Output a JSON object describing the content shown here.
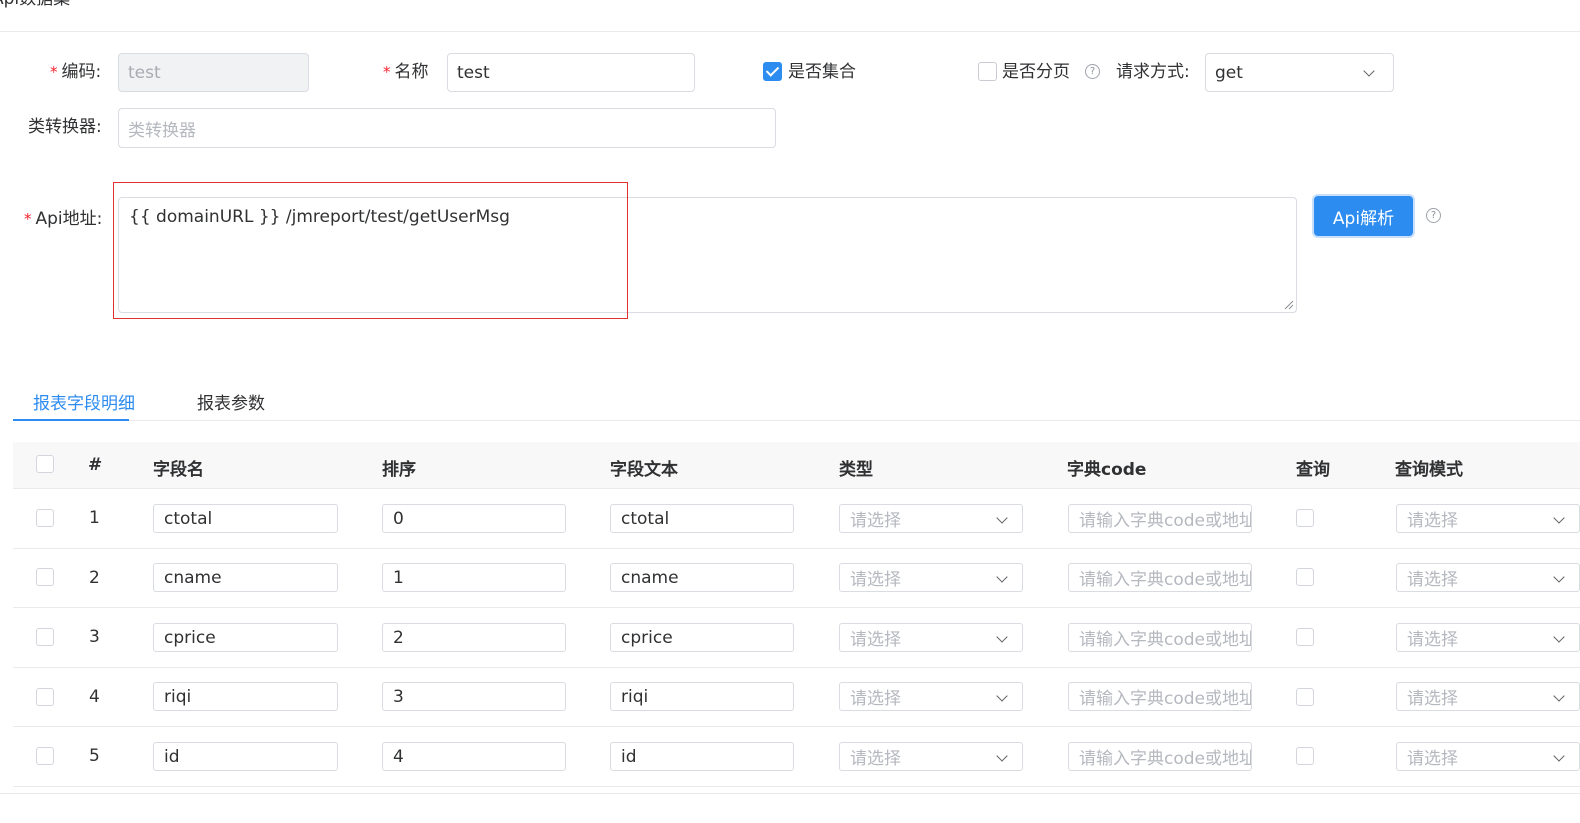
{
  "page": {
    "title": "Api数据集"
  },
  "form": {
    "code": {
      "label": "编码:",
      "value": "test"
    },
    "name": {
      "label": "名称",
      "value": "test"
    },
    "is_collection": {
      "label": "是否集合",
      "checked": true
    },
    "is_paged": {
      "label": "是否分页",
      "checked": false
    },
    "request_method": {
      "label": "请求方式:",
      "value": "get"
    },
    "converter": {
      "label": "类转换器:",
      "placeholder": "类转换器"
    },
    "api_url": {
      "label": "Api地址:",
      "value": "{{ domainURL }} /jmreport/test/getUserMsg"
    },
    "parse_button": "Api解析"
  },
  "tabs": [
    {
      "label": "报表字段明细",
      "active": true
    },
    {
      "label": "报表参数",
      "active": false
    }
  ],
  "table": {
    "columns": [
      "#",
      "字段名",
      "排序",
      "字段文本",
      "类型",
      "字典code",
      "查询",
      "查询模式"
    ],
    "select_placeholder": "请选择",
    "dict_placeholder": "请输入字典code或地址",
    "rows": [
      {
        "num": "1",
        "field": "ctotal",
        "order": "0",
        "text": "ctotal"
      },
      {
        "num": "2",
        "field": "cname",
        "order": "1",
        "text": "cname"
      },
      {
        "num": "3",
        "field": "cprice",
        "order": "2",
        "text": "cprice"
      },
      {
        "num": "4",
        "field": "riqi",
        "order": "3",
        "text": "riqi"
      },
      {
        "num": "5",
        "field": "id",
        "order": "4",
        "text": "id"
      }
    ]
  },
  "colors": {
    "primary": "#2d8cf0",
    "required": "#f5222d",
    "highlight_box": "#e0322f"
  }
}
